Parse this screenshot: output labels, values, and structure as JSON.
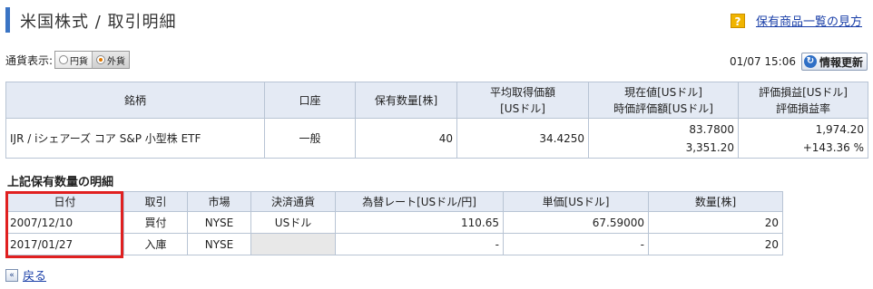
{
  "header": {
    "title": "米国株式 / 取引明細",
    "help_link": "保有商品一覧の見方"
  },
  "currency": {
    "label": "通貨表示:",
    "options": [
      "円貨",
      "外貨"
    ],
    "selected": "外貨"
  },
  "update": {
    "timestamp": "01/07 15:06",
    "refresh_label": "情報更新"
  },
  "holdings": {
    "headers": {
      "name": "銘柄",
      "account": "口座",
      "quantity": "保有数量[株]",
      "avg_price_1": "平均取得価額",
      "avg_price_2": "[USドル]",
      "current_1": "現在値[USドル]",
      "current_2": "時価評価額[USドル]",
      "pl_1": "評価損益[USドル]",
      "pl_2": "評価損益率"
    },
    "row": {
      "name": "IJR / iシェアーズ コア S&P 小型株 ETF",
      "account": "一般",
      "quantity": "40",
      "avg_price": "34.4250",
      "current_price": "83.7800",
      "market_value": "3,351.20",
      "pl": "1,974.20",
      "pl_rate": "+143.36 %"
    }
  },
  "detail": {
    "title": "上記保有数量の明細",
    "headers": [
      "日付",
      "取引",
      "市場",
      "決済通貨",
      "為替レート[USドル/円]",
      "単価[USドル]",
      "数量[株]"
    ],
    "rows": [
      {
        "date": "2007/12/10",
        "trade": "買付",
        "market": "NYSE",
        "currency": "USドル",
        "rate": "110.65",
        "price": "67.59000",
        "qty": "20"
      },
      {
        "date": "2017/01/27",
        "trade": "入庫",
        "market": "NYSE",
        "currency": "",
        "rate": "-",
        "price": "-",
        "qty": "20"
      }
    ]
  },
  "back": {
    "label": "戻る"
  },
  "colors": {
    "accent": "#3a74c4",
    "highlight": "#e02020",
    "header_bg": "#e4eaf4",
    "link": "#1a3fa8"
  }
}
